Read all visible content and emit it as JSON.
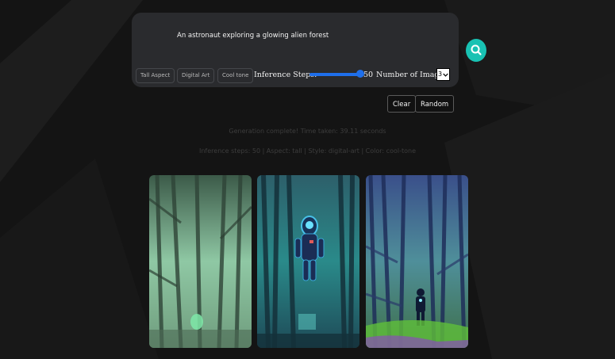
{
  "prompt": {
    "text": "An astronaut exploring a glowing alien forest"
  },
  "chips": [
    {
      "label": "Tall Aspect"
    },
    {
      "label": "Digital Art"
    },
    {
      "label": "Cool tone"
    }
  ],
  "inference": {
    "label": "Inference Steps:",
    "value": "50",
    "slider_fraction": 1.0
  },
  "images_count": {
    "label": "Number of Images:",
    "selected": "3"
  },
  "buttons": {
    "clear": "Clear",
    "random": "Random"
  },
  "status": {
    "line1": "Generation complete! Time taken: 39.11 seconds",
    "line2": "Inference steps: 50 | Aspect: tall | Style: digital-art | Color: cool-tone"
  },
  "colors": {
    "accent_teal": "#19c2b3",
    "slider_blue": "#1f6feb",
    "card_bg": "#2a2b2e"
  },
  "icons": {
    "search": "search-icon",
    "dropdown": "chevron-down-icon"
  }
}
